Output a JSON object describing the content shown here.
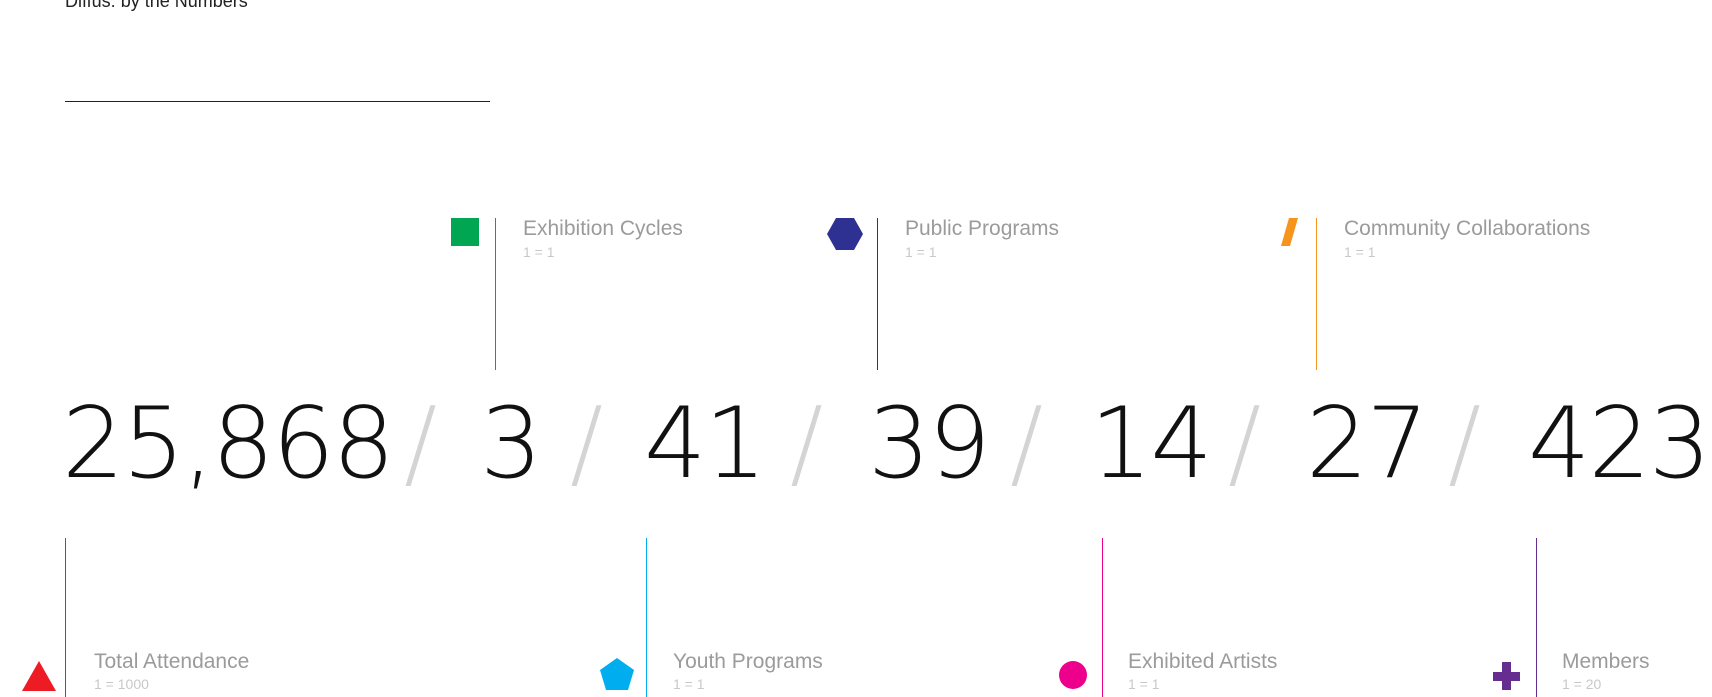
{
  "heading": "Diffus: by the Numbers",
  "separator": "/",
  "numbers": [
    "25,868",
    "3",
    "41",
    "39",
    "14",
    "27",
    "423"
  ],
  "stats": {
    "total_attendance": {
      "label": "Total Attendance",
      "scale": "1 = 1000",
      "color": "#ed1c24",
      "icon": "triangle-icon"
    },
    "exhibition_cycles": {
      "label": "Exhibition Cycles",
      "scale": "1 = 1",
      "color": "#00a651",
      "icon": "square-icon"
    },
    "youth_programs": {
      "label": "Youth Programs",
      "scale": "1 = 1",
      "color": "#00aeef",
      "icon": "pentagon-icon"
    },
    "public_programs": {
      "label": "Public Programs",
      "scale": "1 = 1",
      "color": "#2e3192",
      "icon": "hexagon-icon"
    },
    "exhibited_artists": {
      "label": "Exhibited Artists",
      "scale": "1 = 1",
      "color": "#ec008c",
      "icon": "circle-icon"
    },
    "community_collaborations": {
      "label": "Community Collaborations",
      "scale": "1 = 1",
      "color": "#f7941d",
      "icon": "slash-icon"
    },
    "members": {
      "label": "Members",
      "scale": "1 = 20",
      "color": "#662d91",
      "icon": "plus-icon"
    }
  }
}
